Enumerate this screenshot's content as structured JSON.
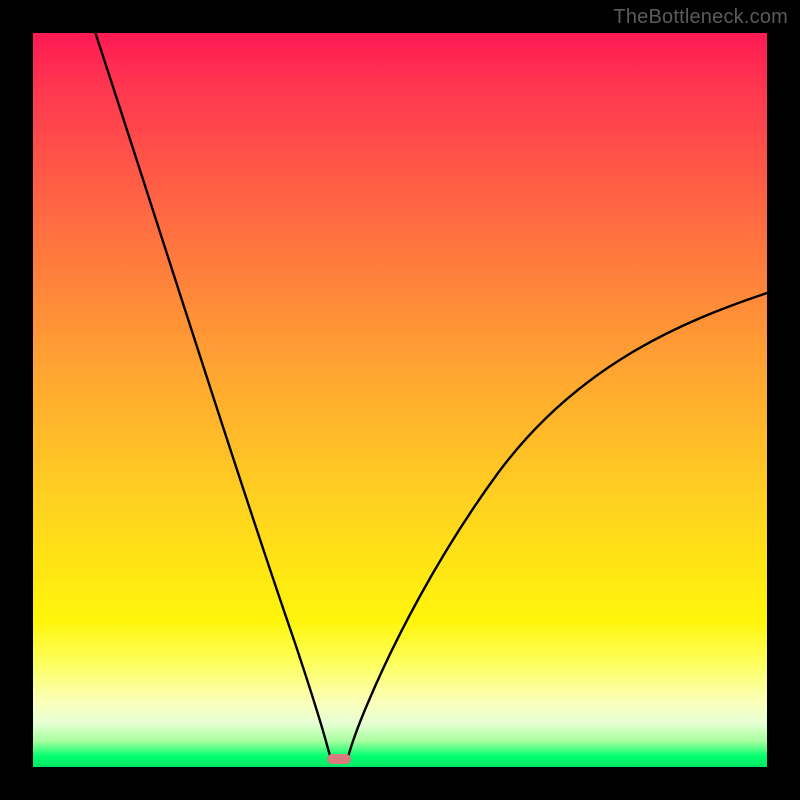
{
  "watermark": {
    "text": "TheBottleneck.com"
  },
  "chart_data": {
    "type": "line",
    "title": "",
    "xlabel": "",
    "ylabel": "",
    "xlim": [
      0,
      100
    ],
    "ylim": [
      0,
      100
    ],
    "grid": false,
    "legend": false,
    "gradient_colors": {
      "top": "#ff1a54",
      "mid_upper": "#ff8a38",
      "mid": "#ffe212",
      "mid_lower": "#fdff60",
      "bottom": "#00e765"
    },
    "marker": {
      "x": 40.8,
      "y": 0.6,
      "w": 3.2,
      "h": 1.3,
      "color": "#d97b7d"
    },
    "series": [
      {
        "name": "left-branch",
        "x": [
          8.5,
          12,
          16,
          20,
          24,
          28,
          32,
          35,
          37,
          38.5,
          39.5,
          40.5
        ],
        "y": [
          100,
          88,
          74,
          60,
          47,
          34,
          22,
          12.5,
          6.5,
          3.3,
          1.6,
          0.6
        ]
      },
      {
        "name": "right-branch",
        "x": [
          42.7,
          44,
          46,
          49,
          53,
          58,
          64,
          71,
          79,
          88,
          98,
          100
        ],
        "y": [
          0.6,
          2.5,
          6.5,
          12.8,
          20.5,
          28.5,
          36.5,
          44.0,
          51.0,
          57.5,
          63.5,
          64.6
        ]
      }
    ]
  }
}
